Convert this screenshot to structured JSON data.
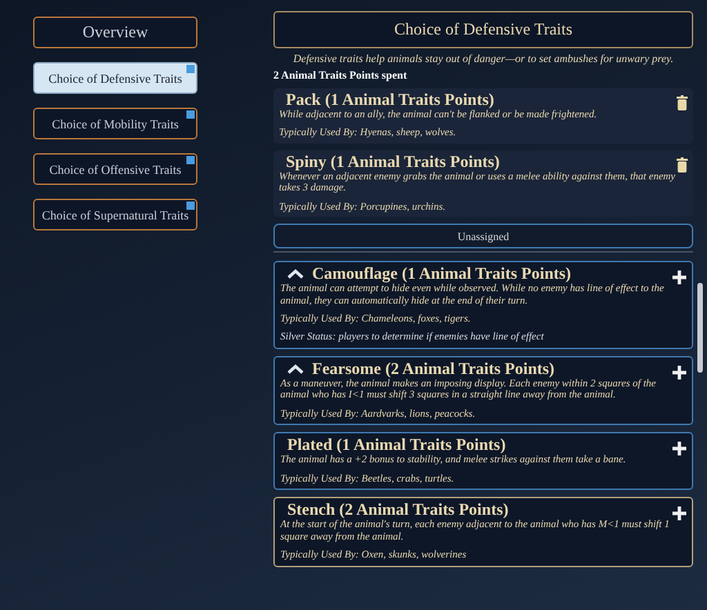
{
  "sidebar": {
    "items": [
      {
        "label": "Overview",
        "selected": false,
        "flagged": false
      },
      {
        "label": "Choice of Defensive Traits",
        "selected": true,
        "flagged": true
      },
      {
        "label": "Choice of Mobility Traits",
        "selected": false,
        "flagged": true
      },
      {
        "label": "Choice of Offensive Traits",
        "selected": false,
        "flagged": true
      },
      {
        "label": "Choice of Supernatural Traits",
        "selected": false,
        "flagged": true
      }
    ]
  },
  "section": {
    "title": "Choice of Defensive Traits",
    "intro": "Defensive traits help animals stay out of danger—or to set ambushes for unwary prey.",
    "spent": "2 Animal Traits Points spent"
  },
  "assigned": [
    {
      "title": "Pack (1 Animal Traits Points)",
      "description": "While adjacent to an ally, the animal can't be flanked or be made frightened.",
      "typical": "Typically Used By: Hyenas, sheep, wolves."
    },
    {
      "title": "Spiny (1 Animal Traits Points)",
      "description": "Whenever an adjacent enemy grabs the animal or uses a melee ability against them, that enemy takes 3 damage.",
      "typical": "Typically Used By: Porcupines, urchins."
    }
  ],
  "unassigned_label": "Unassigned",
  "unassigned": [
    {
      "title": "Camouflage (1 Animal Traits Points)",
      "expanded": true,
      "selected": false,
      "description": "The animal can attempt to hide even while observed. While no enemy has line of effect to the animal, they can automatically hide at the end of their turn.",
      "typical": "Typically Used By: Chameleons, foxes, tigers.",
      "note": "Silver Status: players to determine if enemies have line of effect"
    },
    {
      "title": "Fearsome (2 Animal Traits Points)",
      "expanded": true,
      "selected": false,
      "description": "As a maneuver, the animal makes an imposing display. Each enemy within 2 squares of the animal who has I<1 must shift 3 squares in a straight line away from the animal.",
      "typical": "Typically Used By: Aardvarks, lions, peacocks."
    },
    {
      "title": "Plated (1 Animal Traits Points)",
      "expanded": false,
      "selected": false,
      "description": "The animal has a +2 bonus to stability, and melee strikes against them take a bane.",
      "typical": "Typically Used By: Beetles, crabs, turtles."
    },
    {
      "title": "Stench (2 Animal Traits Points)",
      "expanded": false,
      "selected": true,
      "description": "At the start of the animal's turn, each enemy adjacent to the animal who has M<1 must shift 1 square away from the animal.",
      "typical": "Typically Used By: Oxen, skunks, wolverines"
    }
  ]
}
